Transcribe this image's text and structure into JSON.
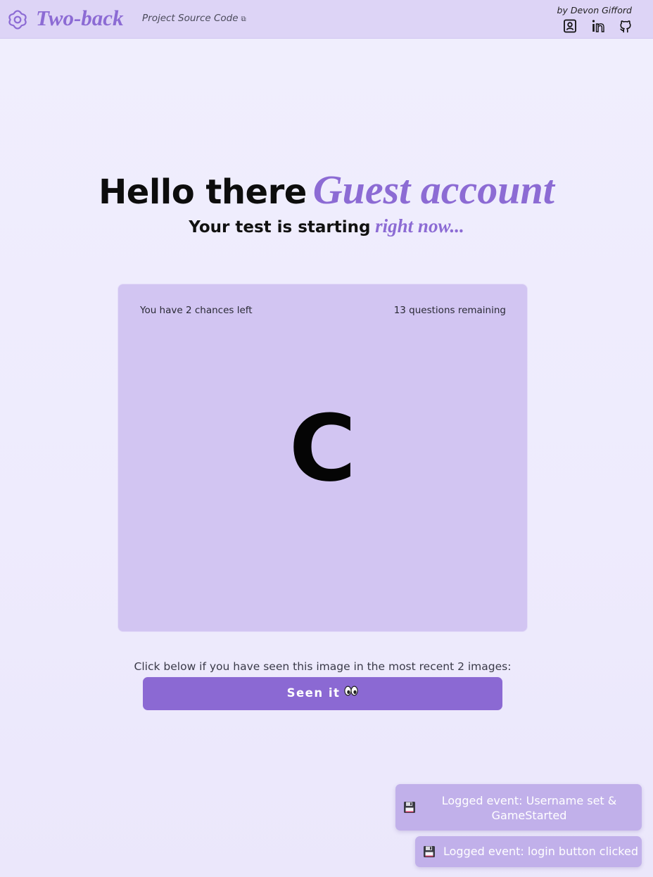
{
  "header": {
    "brand": "Two-back",
    "source_link_label": "Project Source Code",
    "byline": "by Devon Gifford",
    "icons": [
      "gear-flower-icon",
      "external-link-icon",
      "contact-card-icon",
      "linkedin-icon",
      "github-icon"
    ]
  },
  "greeting": {
    "prefix": "Hello there",
    "username": "Guest account"
  },
  "subline": {
    "prefix": "Your test is starting",
    "emphasis": "right now..."
  },
  "game": {
    "chances_text": "You have 2 chances left",
    "remaining_text": "13 questions remaining",
    "current_letter": "C"
  },
  "prompt": "Click below if you have seen this image in the most recent 2 images:",
  "seen_button": {
    "label": "Seen it",
    "icon": "eyes-emoji"
  },
  "toasts": [
    {
      "icon": "floppy-disk-icon",
      "message": "Logged event: Username set & GameStarted"
    },
    {
      "icon": "floppy-disk-icon",
      "message": "Logged event: login button clicked"
    }
  ],
  "colors": {
    "accent": "#8c6bd4",
    "header_bg": "#ddd4f6",
    "card_bg": "#d2c5f2",
    "button_bg": "#8b69d3",
    "toast_bg": "#c1b0ea"
  }
}
